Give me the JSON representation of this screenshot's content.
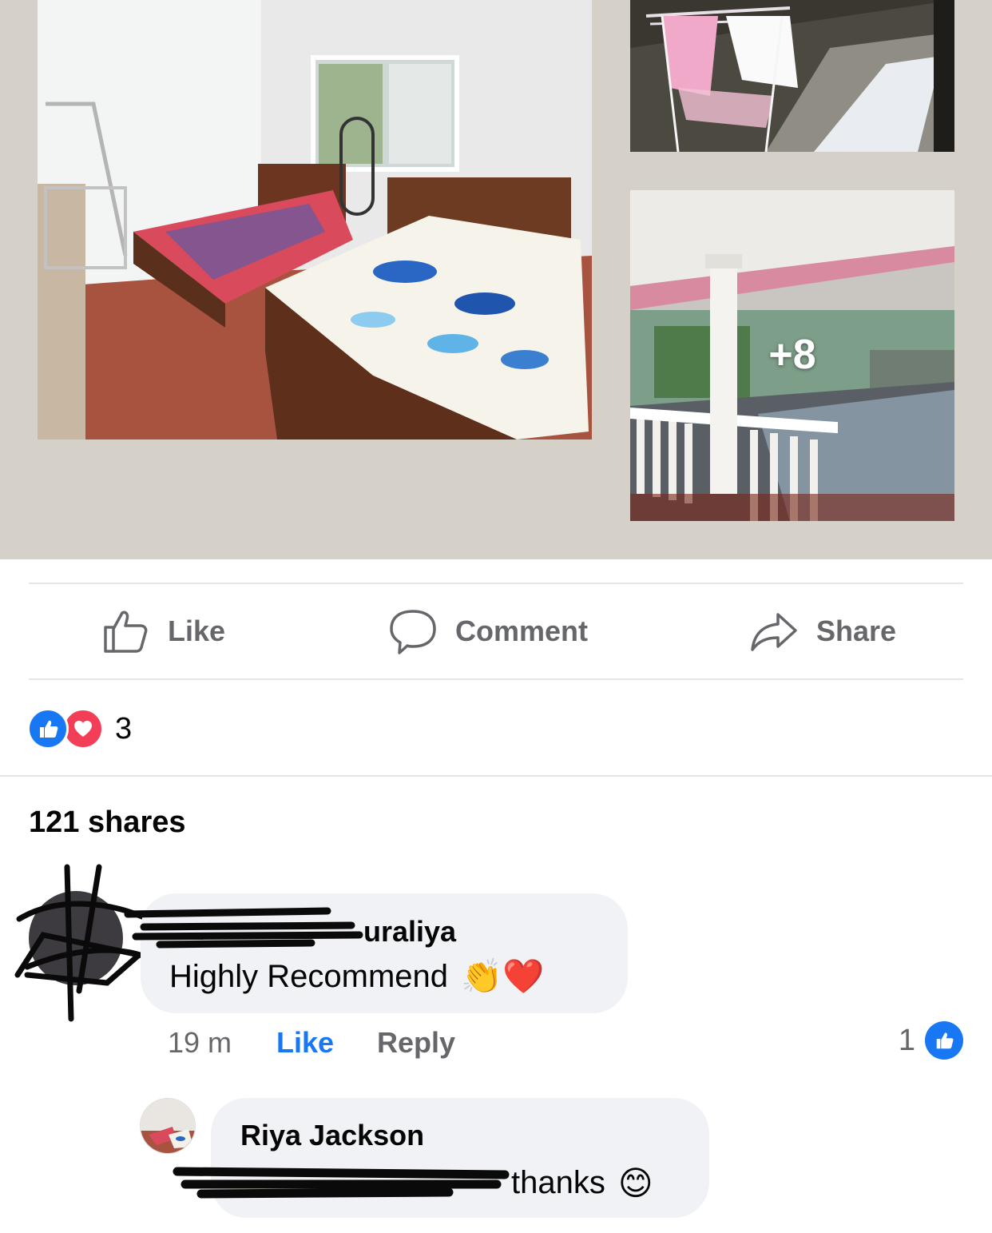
{
  "post": {
    "photos": [
      {
        "name": "bedroom-photo"
      },
      {
        "name": "laundry-rack-photo"
      },
      {
        "name": "veranda-photo",
        "overlay": "+8"
      }
    ]
  },
  "actions": {
    "like_label": "Like",
    "comment_label": "Comment",
    "share_label": "Share"
  },
  "reactions": {
    "icons": [
      "like-reaction-icon",
      "love-reaction-icon"
    ],
    "count": "3"
  },
  "shares_label": "121 shares",
  "comments": [
    {
      "author_visible": "uraliya",
      "text": "Highly Recommend",
      "emoji": "👏❤️",
      "time": "19 m",
      "like_label": "Like",
      "reply_label": "Reply",
      "like_count": "1"
    }
  ],
  "replies": [
    {
      "author": "Riya Jackson",
      "text": "thanks",
      "emoji": "😊"
    }
  ],
  "colors": {
    "brand_blue": "#1877f2",
    "love_red": "#f33e58",
    "secondary_text": "#65676b",
    "bubble_bg": "#f0f2f5",
    "collage_bg": "#d6d1c8"
  }
}
